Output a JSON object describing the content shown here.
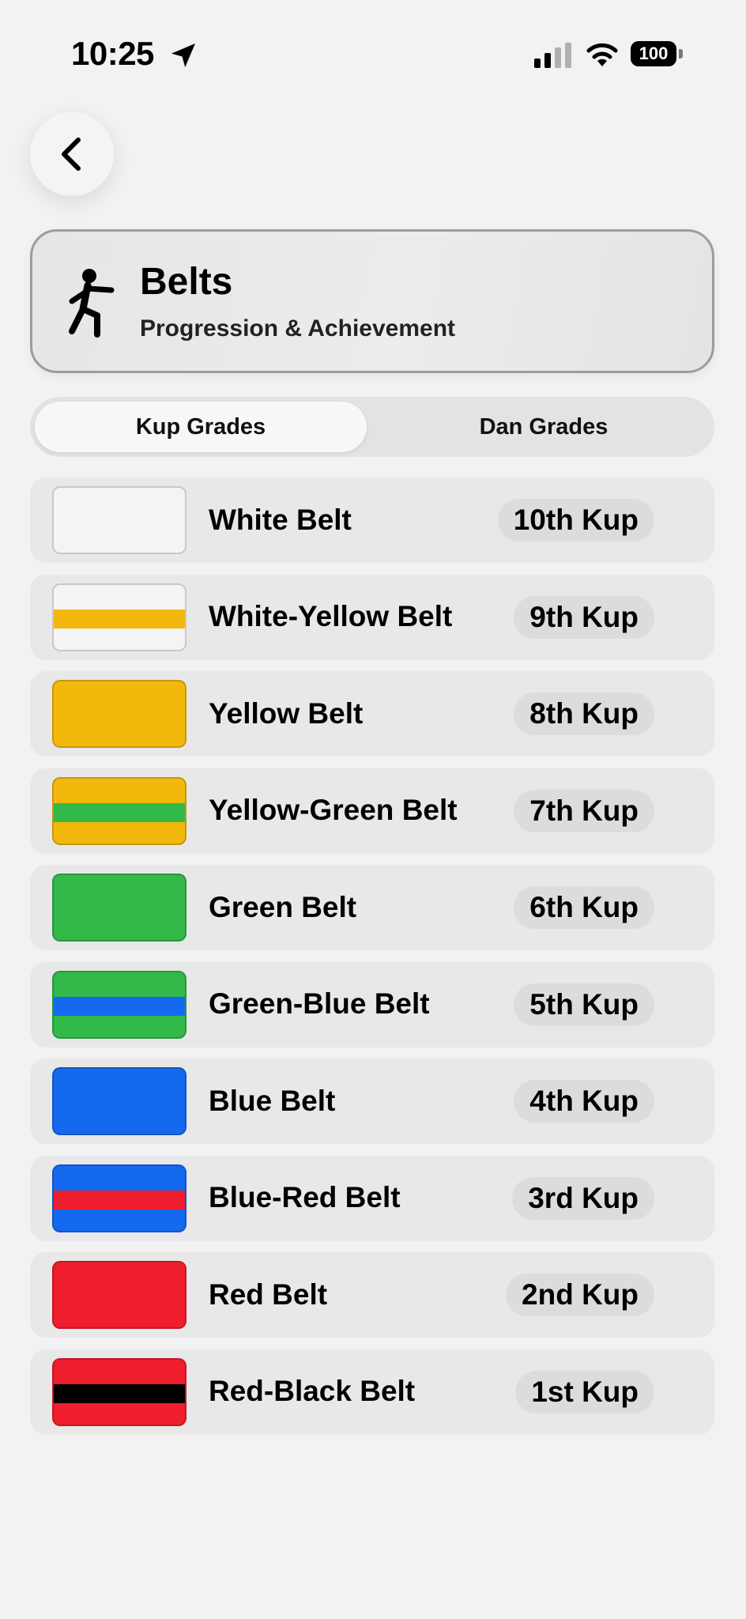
{
  "status_bar": {
    "time": "10:25",
    "battery": "100"
  },
  "header": {
    "title": "Belts",
    "subtitle": "Progression & Achievement"
  },
  "tabs": [
    {
      "label": "Kup Grades",
      "selected": true
    },
    {
      "label": "Dan Grades",
      "selected": false
    }
  ],
  "belts": [
    {
      "name": "White Belt",
      "grade": "10th Kup",
      "base_color": "#f4f4f4",
      "stripe_color": null
    },
    {
      "name": "White-Yellow Belt",
      "grade": "9th Kup",
      "base_color": "#f4f4f4",
      "stripe_color": "#f2b90c"
    },
    {
      "name": "Yellow Belt",
      "grade": "8th Kup",
      "base_color": "#f2b90c",
      "stripe_color": null
    },
    {
      "name": "Yellow-Green Belt",
      "grade": "7th Kup",
      "base_color": "#f2b90c",
      "stripe_color": "#33b84a"
    },
    {
      "name": "Green Belt",
      "grade": "6th Kup",
      "base_color": "#33b84a",
      "stripe_color": null
    },
    {
      "name": "Green-Blue Belt",
      "grade": "5th Kup",
      "base_color": "#33b84a",
      "stripe_color": "#1469ee"
    },
    {
      "name": "Blue Belt",
      "grade": "4th Kup",
      "base_color": "#1469ee",
      "stripe_color": null
    },
    {
      "name": "Blue-Red Belt",
      "grade": "3rd Kup",
      "base_color": "#1469ee",
      "stripe_color": "#ee1e2d"
    },
    {
      "name": "Red Belt",
      "grade": "2nd Kup",
      "base_color": "#ee1e2d",
      "stripe_color": null
    },
    {
      "name": "Red-Black Belt",
      "grade": "1st Kup",
      "base_color": "#ee1e2d",
      "stripe_color": "#000000"
    }
  ]
}
